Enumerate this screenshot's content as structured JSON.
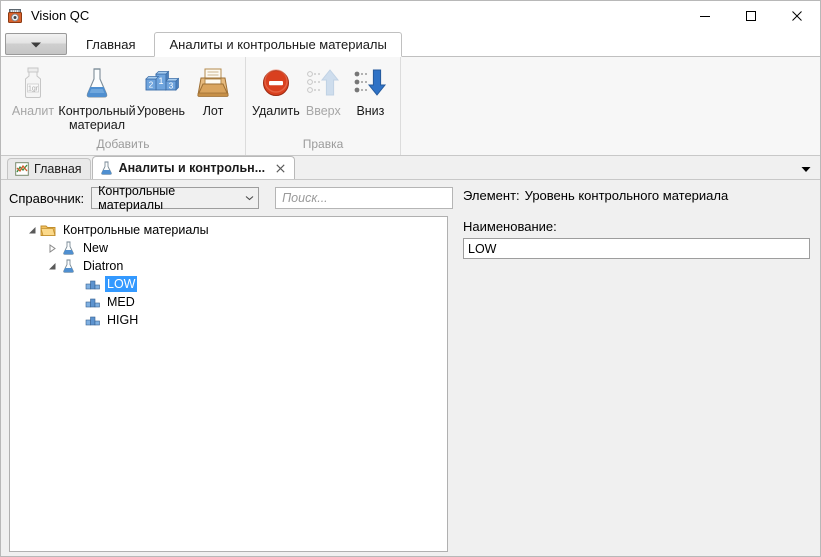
{
  "window": {
    "title": "Vision QC",
    "app_icon": "disc-icon",
    "minimize_label": "Свернуть",
    "maximize_label": "Развернуть",
    "close_label": "Закрыть"
  },
  "ribbon": {
    "app_menu_icon": "chevron-down-icon",
    "tabs": [
      {
        "label": "Главная",
        "active": false
      },
      {
        "label": "Аналиты и контрольные материалы",
        "active": true
      }
    ],
    "groups": [
      {
        "label": "Добавить",
        "buttons": [
          {
            "label": "Аналит",
            "icon": "vial-1gr-icon",
            "disabled": true
          },
          {
            "label": "Контрольный материал",
            "icon": "flask-icon",
            "disabled": false
          },
          {
            "label": "Уровень",
            "icon": "podium-icon",
            "disabled": false
          },
          {
            "label": "Лот",
            "icon": "inbox-tray-icon",
            "disabled": false
          }
        ]
      },
      {
        "label": "Правка",
        "buttons": [
          {
            "label": "Удалить",
            "icon": "delete-circle-icon",
            "disabled": false
          },
          {
            "label": "Вверх",
            "icon": "arrow-up-icon",
            "disabled": true
          },
          {
            "label": "Вниз",
            "icon": "arrow-down-icon",
            "disabled": false
          }
        ]
      }
    ]
  },
  "doc_tabs": {
    "items": [
      {
        "label": "Главная",
        "icon": "chart-icon",
        "active": false,
        "closable": false
      },
      {
        "label": "Аналиты и контрольн...",
        "icon": "flask-icon",
        "active": true,
        "closable": true,
        "close_icon": "close-icon"
      }
    ],
    "overflow_icon": "chevron-down-icon"
  },
  "left_pane": {
    "filter_label": "Справочник:",
    "combo_value": "Контрольные материалы",
    "combo_arrow_icon": "chevron-down-icon",
    "search_placeholder": "Поиск...",
    "tree": [
      {
        "label": "Контрольные материалы",
        "level": 0,
        "icon": "folder-icon",
        "toggle": "expanded",
        "selected": false
      },
      {
        "label": "New",
        "level": 1,
        "icon": "flask-icon",
        "toggle": "collapsed",
        "selected": false
      },
      {
        "label": "Diatron",
        "level": 1,
        "icon": "flask-icon",
        "toggle": "expanded",
        "selected": false
      },
      {
        "label": "LOW",
        "level": 2,
        "icon": "podium-icon",
        "toggle": "none",
        "selected": true
      },
      {
        "label": "MED",
        "level": 2,
        "icon": "podium-icon",
        "toggle": "none",
        "selected": false
      },
      {
        "label": "HIGH",
        "level": 2,
        "icon": "podium-icon",
        "toggle": "none",
        "selected": false
      }
    ]
  },
  "right_pane": {
    "element_label": "Элемент:",
    "element_value": "Уровень контрольного материала",
    "name_label": "Наименование:",
    "name_value": "LOW"
  },
  "colors": {
    "selection_blue": "#3399ff",
    "accent_orange": "#d94f2b",
    "flask_blue": "#5b8fc9",
    "folder_yellow": "#f6c358",
    "arrow_blue": "#2f72c6",
    "ribbon_bg": "#f7f7f7",
    "content_bg": "#f0f0f0"
  }
}
